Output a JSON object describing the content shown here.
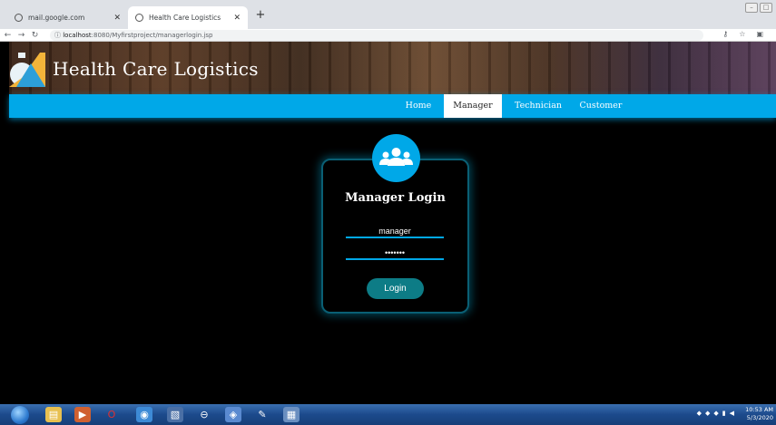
{
  "browser": {
    "tabs": [
      {
        "label": "mail.google.com",
        "active": false
      },
      {
        "label": "Health Care Logistics",
        "active": true
      }
    ],
    "url_host": "localhost",
    "url_rest": ":8080/Myfirstproject/managerlogin.jsp"
  },
  "site": {
    "title": "Health Care Logistics",
    "nav": [
      "Home",
      "Manager",
      "Technician",
      "Customer"
    ],
    "active_nav": "Manager"
  },
  "login": {
    "title": "Manager Login",
    "username_value": "manager",
    "password_value": "•••••••",
    "button_label": "Login"
  },
  "taskbar": {
    "time": "10:53 AM",
    "date": "5/3/2020"
  },
  "colors": {
    "accent": "#00a8e8",
    "button": "#0d7c86",
    "page_bg": "#000000"
  }
}
